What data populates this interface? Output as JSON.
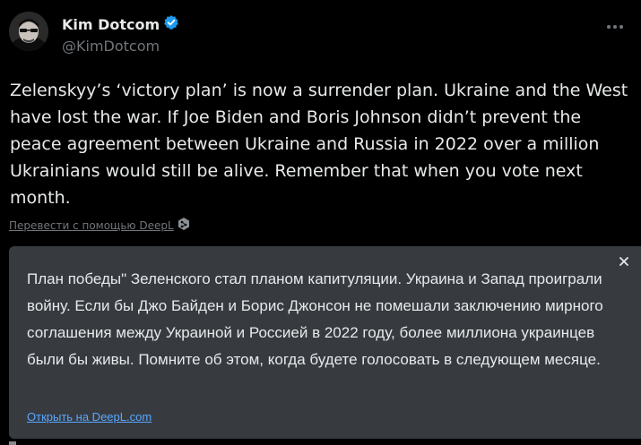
{
  "author": {
    "display_name": "Kim Dotcom",
    "handle": "@KimDotcom",
    "verified_icon": "verified-badge-icon",
    "verified_color": "#1d9bf0"
  },
  "tweet": {
    "text": "Zelenskyy’s ‘victory plan’ is now a surrender plan. Ukraine and the West have lost the war. If Joe Biden and Boris Johnson didn’t prevent the peace agreement between Ukraine and Russia in 2022 over a million Ukrainians would still be alive. Remember that when you vote next month."
  },
  "translate": {
    "link_label": "Перевести с помощью DeepL",
    "deepl_icon": "deepl-icon",
    "translated_text": "План победы\" Зеленского стал планом капитуляции. Украина и Запад проиграли войну. Если бы Джо Байден и Борис Джонсон не помешали заключению мирного соглашения между Украиной и Россией в 2022 году, более миллиона украинцев были бы живы. Помните об этом, когда будете голосовать в следующем месяце.",
    "open_link_label": "Открыть на DeepL.com",
    "close_icon": "close-icon",
    "link_color": "#5aa7ff"
  },
  "colors": {
    "background": "#000000",
    "text": "#e7e9ea",
    "muted": "#71767b",
    "panel": "#373b40"
  }
}
